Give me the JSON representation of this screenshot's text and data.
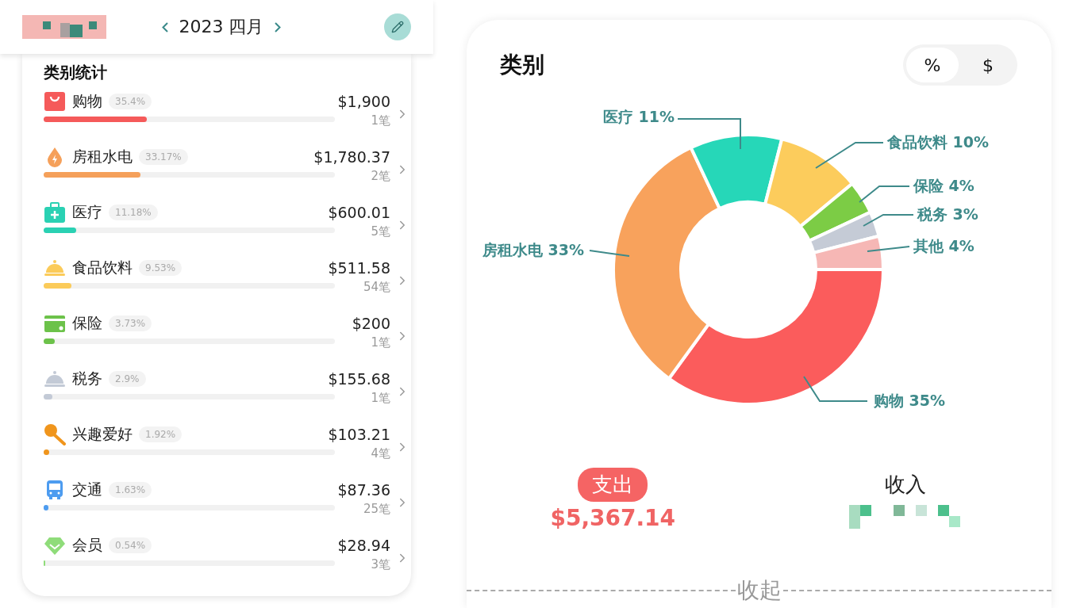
{
  "header": {
    "month": "2023 四月"
  },
  "category_list": {
    "title": "类别统计",
    "items": [
      {
        "name": "购物",
        "percent": "35.4%",
        "amount": "$1,900",
        "count": "1笔",
        "level": 0.354,
        "color": "#f55a5a"
      },
      {
        "name": "房租水电",
        "percent": "33.17%",
        "amount": "$1,780.37",
        "count": "2笔",
        "level": 0.332,
        "color": "#f5a05a"
      },
      {
        "name": "医疗",
        "percent": "11.18%",
        "amount": "$600.01",
        "count": "5笔",
        "level": 0.112,
        "color": "#2ad1b3"
      },
      {
        "name": "食品饮料",
        "percent": "9.53%",
        "amount": "$511.58",
        "count": "54笔",
        "level": 0.095,
        "color": "#fbcb5a"
      },
      {
        "name": "保险",
        "percent": "3.73%",
        "amount": "$200",
        "count": "1笔",
        "level": 0.037,
        "color": "#6cc24a"
      },
      {
        "name": "税务",
        "percent": "2.9%",
        "amount": "$155.68",
        "count": "1笔",
        "level": 0.029,
        "color": "#c3cad6"
      },
      {
        "name": "兴趣爱好",
        "percent": "1.92%",
        "amount": "$103.21",
        "count": "4笔",
        "level": 0.019,
        "color": "#f0951c"
      },
      {
        "name": "交通",
        "percent": "1.63%",
        "amount": "$87.36",
        "count": "25笔",
        "level": 0.016,
        "color": "#4d9cf0"
      },
      {
        "name": "会员",
        "percent": "0.54%",
        "amount": "$28.94",
        "count": "3笔",
        "level": 0.005,
        "color": "#8fdc7a"
      }
    ]
  },
  "chart_panel": {
    "title": "类别",
    "toggle": [
      {
        "label": "%",
        "selected": true
      },
      {
        "label": "$",
        "selected": false
      }
    ],
    "chart_data": {
      "type": "donut",
      "categories": [
        "购物",
        "房租水电",
        "医疗",
        "食品饮料",
        "保险",
        "税务",
        "其他"
      ],
      "values": [
        35,
        33,
        11,
        10,
        4,
        3,
        4
      ],
      "value_labels": [
        "35%",
        "33%",
        "11%",
        "10%",
        "4%",
        "3%",
        "4%"
      ]
    },
    "summary": [
      {
        "label": "支出",
        "amount": "$5,367.14",
        "selected": true
      },
      {
        "label": "收入",
        "selected": false
      }
    ],
    "collapse": "收起"
  }
}
